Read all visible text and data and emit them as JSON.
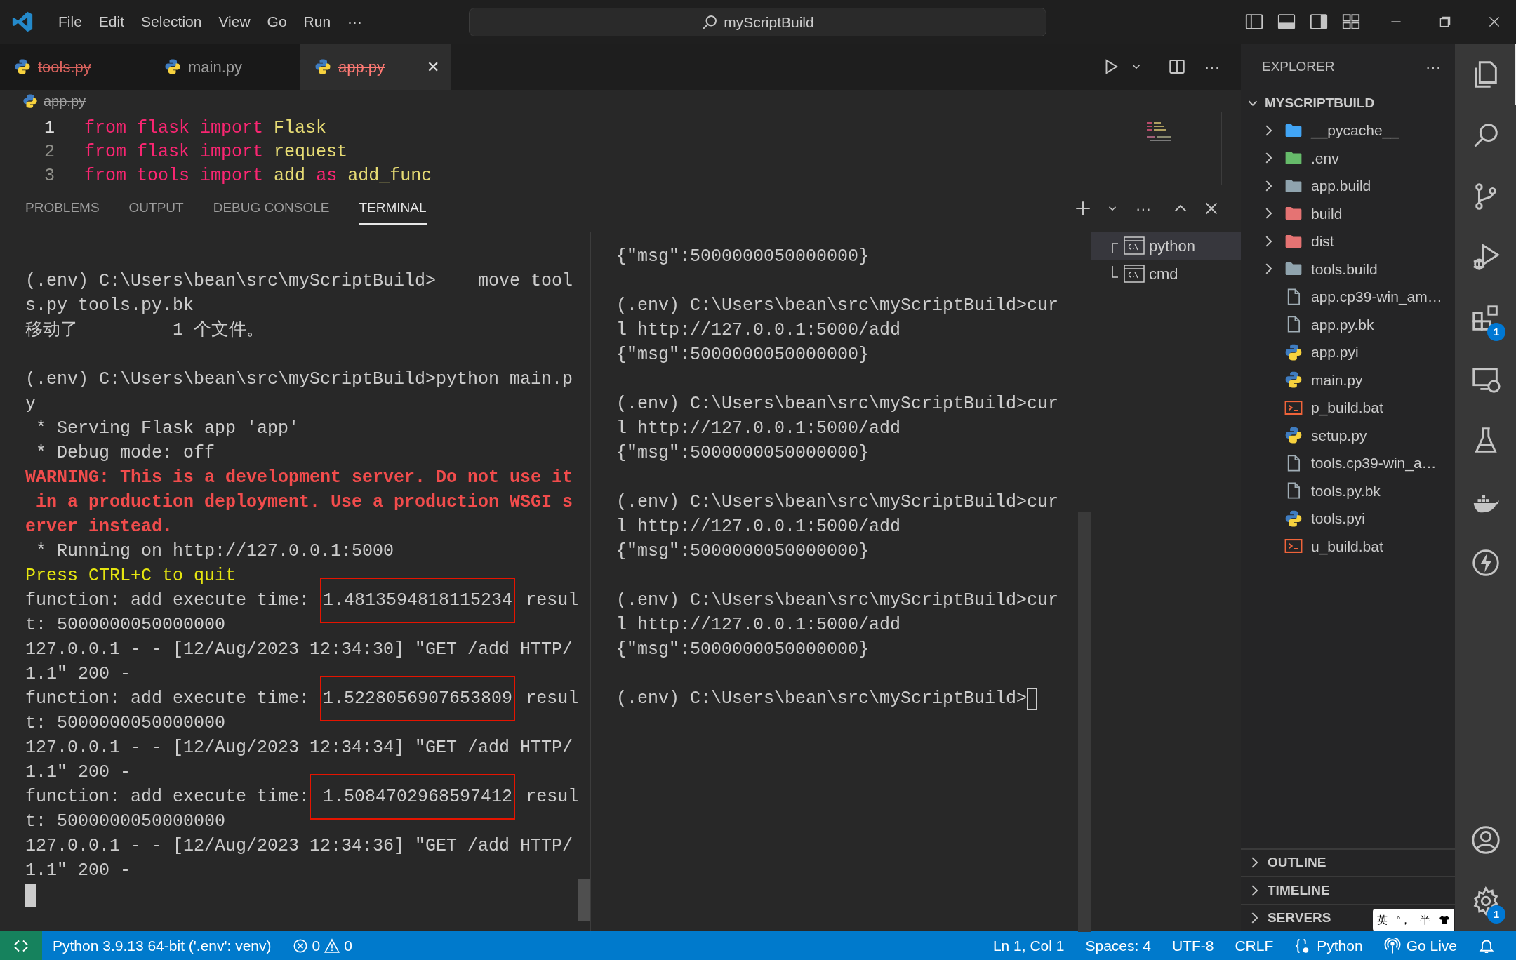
{
  "title_bar": {
    "menu": [
      "File",
      "Edit",
      "Selection",
      "View",
      "Go",
      "Run",
      "···"
    ],
    "search": {
      "value": "myScriptBuild"
    }
  },
  "editor_tabs": [
    {
      "label": "tools.py",
      "selected": false,
      "deleted": true
    },
    {
      "label": "main.py",
      "selected": false,
      "deleted": false
    },
    {
      "label": "app.py",
      "selected": true,
      "deleted": true,
      "close": "✕"
    }
  ],
  "editor_actions": {
    "more": "···"
  },
  "breadcrumb": {
    "label": "app.py",
    "deleted": true
  },
  "code": [
    {
      "number": "1",
      "tokens": [
        {
          "text": "from",
          "kind": "keyword"
        },
        {
          "text": "flask",
          "kind": "keyword"
        },
        {
          "text": "import",
          "kind": "keyword"
        },
        {
          "text": "Flask",
          "kind": "name"
        }
      ]
    },
    {
      "number": "2",
      "tokens": [
        {
          "text": "from",
          "kind": "keyword"
        },
        {
          "text": "flask",
          "kind": "keyword"
        },
        {
          "text": "import",
          "kind": "keyword"
        },
        {
          "text": "request",
          "kind": "name"
        }
      ]
    },
    {
      "number": "3",
      "tokens": [
        {
          "text": "from",
          "kind": "keyword"
        },
        {
          "text": "tools",
          "kind": "keyword"
        },
        {
          "text": "import",
          "kind": "keyword"
        },
        {
          "text": "add",
          "kind": "name"
        },
        {
          "text": "as",
          "kind": "keyword"
        },
        {
          "text": "add_func",
          "kind": "name"
        }
      ]
    }
  ],
  "panel": {
    "tabs": [
      {
        "label": "PROBLEMS",
        "selected": false
      },
      {
        "label": "OUTPUT",
        "selected": false
      },
      {
        "label": "DEBUG CONSOLE",
        "selected": false
      },
      {
        "label": "TERMINAL",
        "selected": true
      }
    ],
    "more": "···"
  },
  "terminal_left": [
    {
      "kind": "blank"
    },
    {
      "kind": "text",
      "text": "(.env) C:\\Users\\bean\\src\\myScriptBuild>    move tool"
    },
    {
      "kind": "text",
      "text": "s.py tools.py.bk"
    },
    {
      "kind": "text",
      "text": "移动了         1 个文件。"
    },
    {
      "kind": "blank"
    },
    {
      "kind": "text",
      "text": "(.env) C:\\Users\\bean\\src\\myScriptBuild>python main.p"
    },
    {
      "kind": "text",
      "text": "y"
    },
    {
      "kind": "text",
      "text": " * Serving Flask app 'app'"
    },
    {
      "kind": "text",
      "text": " * Debug mode: off"
    },
    {
      "kind": "warning",
      "text": "WARNING: This is a development server. Do not use it"
    },
    {
      "kind": "warning",
      "text": " in a production deployment. Use a production WSGI s"
    },
    {
      "kind": "warning",
      "text": "erver instead."
    },
    {
      "kind": "text",
      "text": " * Running on http://127.0.0.1:5000"
    },
    {
      "kind": "notice",
      "text": "Press CTRL+C to quit"
    },
    {
      "kind": "timing",
      "before": "function: add execute time: ",
      "value": "1.4813594818115234",
      "after": " resul"
    },
    {
      "kind": "text",
      "text": "t: 5000000050000000"
    },
    {
      "kind": "text",
      "text": "127.0.0.1 - - [12/Aug/2023 12:34:30] \"GET /add HTTP/"
    },
    {
      "kind": "text",
      "text": "1.1\" 200 -"
    },
    {
      "kind": "timing",
      "before": "function: add execute time: ",
      "value": "1.5228056907653809",
      "after": " resul"
    },
    {
      "kind": "text",
      "text": "t: 5000000050000000"
    },
    {
      "kind": "text",
      "text": "127.0.0.1 - - [12/Aug/2023 12:34:34] \"GET /add HTTP/"
    },
    {
      "kind": "text",
      "text": "1.1\" 200 -"
    },
    {
      "kind": "timing",
      "before": "function: add execute time:",
      "value": " 1.5084702968597412",
      "after": " resul"
    },
    {
      "kind": "text",
      "text": "t: 5000000050000000"
    },
    {
      "kind": "text",
      "text": "127.0.0.1 - - [12/Aug/2023 12:34:36] \"GET /add HTTP/"
    },
    {
      "kind": "text",
      "text": "1.1\" 200 -"
    },
    {
      "kind": "cursor"
    }
  ],
  "terminal_right": [
    {
      "kind": "text",
      "text": "{\"msg\":5000000050000000}"
    },
    {
      "kind": "blank"
    },
    {
      "kind": "text",
      "text": "(.env) C:\\Users\\bean\\src\\myScriptBuild>cur"
    },
    {
      "kind": "text",
      "text": "l http://127.0.0.1:5000/add"
    },
    {
      "kind": "text",
      "text": "{\"msg\":5000000050000000}"
    },
    {
      "kind": "blank"
    },
    {
      "kind": "text",
      "text": "(.env) C:\\Users\\bean\\src\\myScriptBuild>cur"
    },
    {
      "kind": "text",
      "text": "l http://127.0.0.1:5000/add"
    },
    {
      "kind": "text",
      "text": "{\"msg\":5000000050000000}"
    },
    {
      "kind": "blank"
    },
    {
      "kind": "text",
      "text": "(.env) C:\\Users\\bean\\src\\myScriptBuild>cur"
    },
    {
      "kind": "text",
      "text": "l http://127.0.0.1:5000/add"
    },
    {
      "kind": "text",
      "text": "{\"msg\":5000000050000000}"
    },
    {
      "kind": "blank"
    },
    {
      "kind": "text",
      "text": "(.env) C:\\Users\\bean\\src\\myScriptBuild>cur"
    },
    {
      "kind": "text",
      "text": "l http://127.0.0.1:5000/add"
    },
    {
      "kind": "text",
      "text": "{\"msg\":5000000050000000}"
    },
    {
      "kind": "blank"
    },
    {
      "kind": "prompt_cursor",
      "text": "(.env) C:\\Users\\bean\\src\\myScriptBuild>"
    }
  ],
  "terminal_list": [
    {
      "label": "python",
      "selected": true
    },
    {
      "label": "cmd",
      "selected": false
    }
  ],
  "explorer": {
    "title": "EXPLORER",
    "more": "···",
    "root": {
      "label": "MYSCRIPTBUILD",
      "expanded": true
    },
    "items": [
      {
        "kind": "folder",
        "label": "__pycache__",
        "color": "#42a5f5",
        "expanded": false
      },
      {
        "kind": "folder",
        "label": ".env",
        "color": "#66bb6a",
        "expanded": false
      },
      {
        "kind": "folder",
        "label": "app.build",
        "color": "#90a4ae",
        "expanded": false
      },
      {
        "kind": "folder",
        "label": "build",
        "color": "#e57373",
        "expanded": false
      },
      {
        "kind": "folder",
        "label": "dist",
        "color": "#e57373",
        "expanded": false
      },
      {
        "kind": "folder",
        "label": "tools.build",
        "color": "#90a4ae",
        "expanded": false
      },
      {
        "kind": "file",
        "label": "app.cp39-win_am…"
      },
      {
        "kind": "file",
        "label": "app.py.bk"
      },
      {
        "kind": "python",
        "label": "app.pyi"
      },
      {
        "kind": "python",
        "label": "main.py"
      },
      {
        "kind": "shell",
        "label": "p_build.bat"
      },
      {
        "kind": "python",
        "label": "setup.py"
      },
      {
        "kind": "file",
        "label": "tools.cp39-win_a…"
      },
      {
        "kind": "file",
        "label": "tools.py.bk"
      },
      {
        "kind": "python",
        "label": "tools.pyi"
      },
      {
        "kind": "shell",
        "label": "u_build.bat"
      }
    ],
    "sections": [
      {
        "label": "OUTLINE",
        "expanded": false
      },
      {
        "label": "TIMELINE",
        "expanded": false
      },
      {
        "label": "SERVERS",
        "expanded": false
      }
    ]
  },
  "activity_bar": {
    "items": [
      {
        "selected": true
      },
      {
        "selected": false
      },
      {
        "selected": false
      },
      {
        "selected": false
      },
      {
        "selected": false,
        "badge": "1"
      },
      {
        "selected": false
      },
      {
        "selected": false
      },
      {
        "selected": false
      },
      {
        "selected": false
      }
    ],
    "bottom": [
      {
        "selected": false
      },
      {
        "selected": false,
        "badge": "1"
      }
    ]
  },
  "ime": {
    "mode": "英",
    "punct": "°，",
    "width": "半"
  },
  "status_bar": {
    "interpreter": "Python 3.9.13 64-bit ('.env': venv)",
    "errors": "0",
    "warnings": "0",
    "position": "Ln 1, Col 1",
    "spaces": "Spaces: 4",
    "encoding": "UTF-8",
    "eol": "CRLF",
    "language": "Python",
    "live": "Go Live"
  }
}
